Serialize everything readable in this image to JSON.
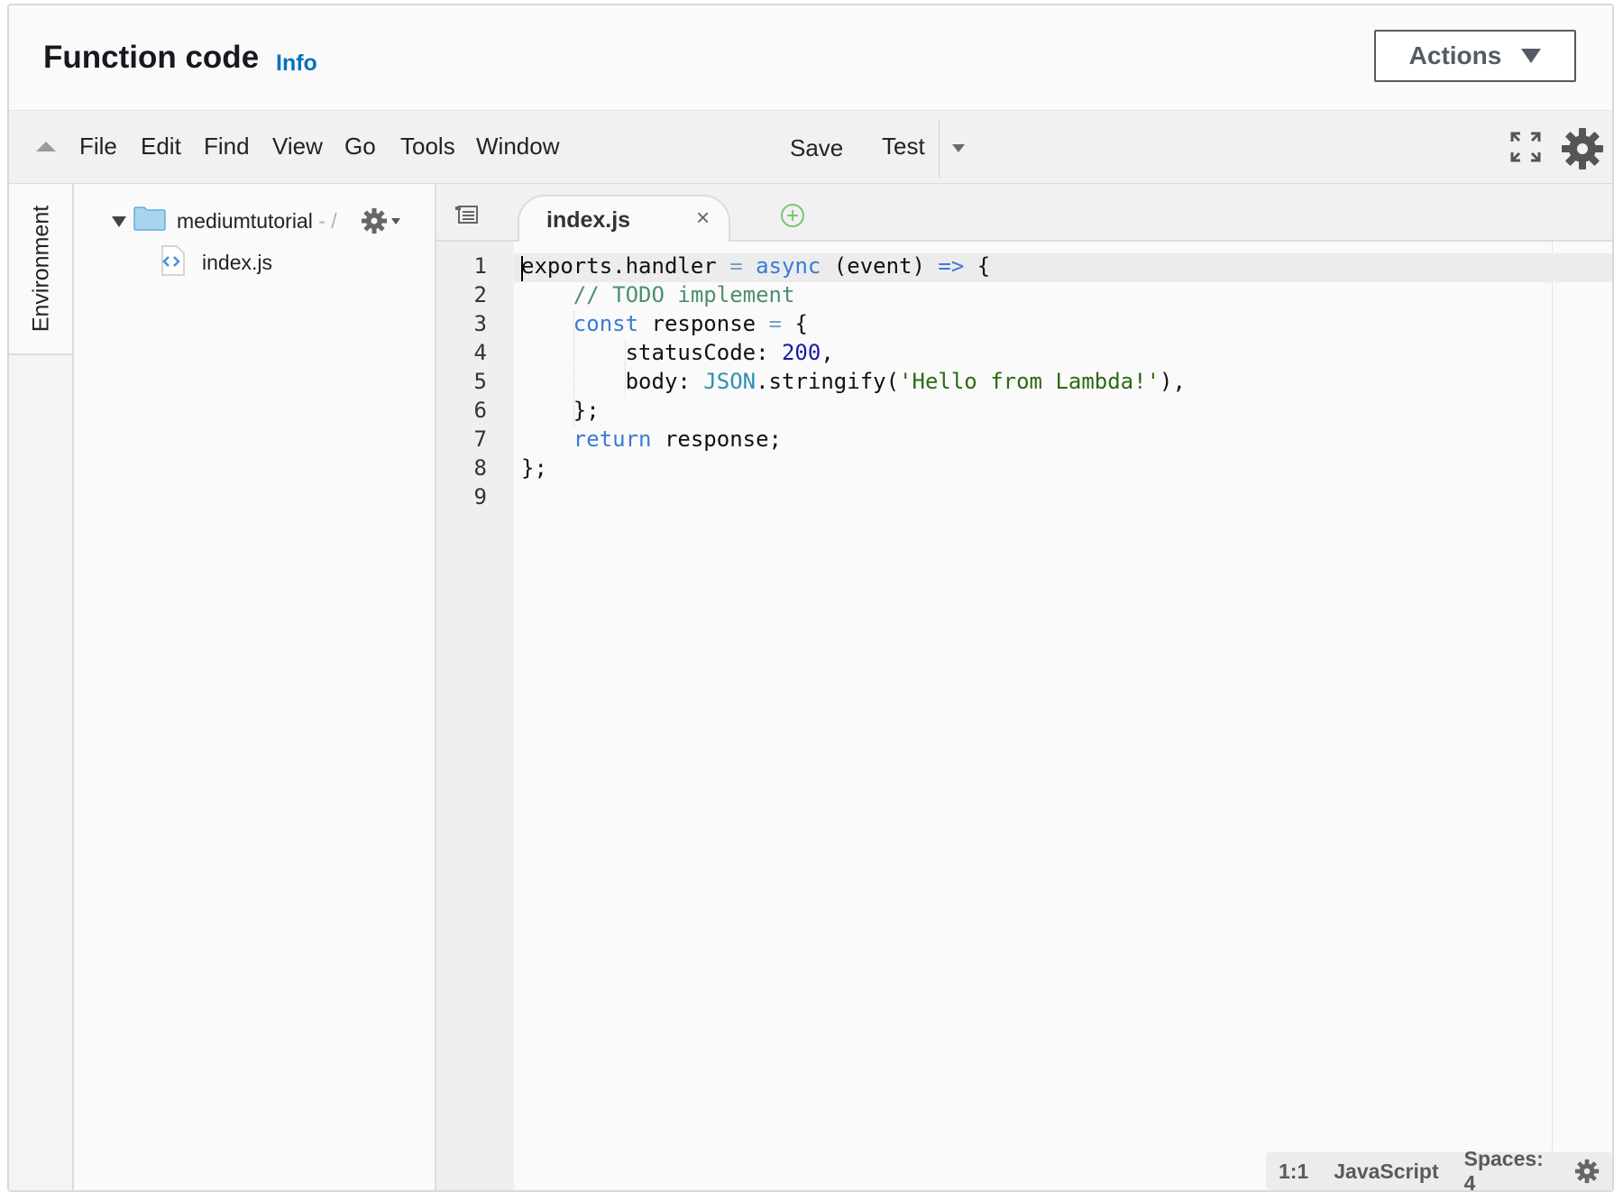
{
  "header": {
    "title": "Function code",
    "info_link": "Info",
    "actions_label": "Actions"
  },
  "menubar": {
    "items": [
      "File",
      "Edit",
      "Find",
      "View",
      "Go",
      "Tools",
      "Window"
    ],
    "save_label": "Save",
    "test_label": "Test"
  },
  "sidebar": {
    "environment_label": "Environment"
  },
  "tree": {
    "folder_name": "mediumtutorial",
    "folder_suffix": " - /",
    "file_name": "index.js"
  },
  "editor": {
    "tab_label": "index.js",
    "line_numbers": [
      "1",
      "2",
      "3",
      "4",
      "5",
      "6",
      "7",
      "8",
      "9"
    ],
    "code": {
      "l1": {
        "a": "xports.handler ",
        "b": "=",
        "c": " ",
        "d": "async",
        "e": " (event) ",
        "f": "=>",
        "g": " {",
        "first": "e"
      },
      "l2": {
        "indent": "    ",
        "comment": "// TODO implement"
      },
      "l3": {
        "indent": "    ",
        "kw": "const",
        "a": " response ",
        "op": "=",
        "b": " {"
      },
      "l4": {
        "indent": "        ",
        "a": "statusCode: ",
        "num": "200",
        "b": ","
      },
      "l5": {
        "indent": "        ",
        "a": "body: ",
        "obj": "JSON",
        "b": ".stringify(",
        "str": "'Hello from Lambda!'",
        "c": "),"
      },
      "l6": {
        "indent": "    ",
        "a": "};"
      },
      "l7": {
        "indent": "    ",
        "kw": "return",
        "a": " response;"
      },
      "l8": {
        "a": "};"
      }
    }
  },
  "status": {
    "position": "1:1",
    "language": "JavaScript",
    "spaces": "Spaces: 4"
  },
  "colors": {
    "link": "#0073bb",
    "keyword": "#3a7ad9",
    "comment": "#4d8f6f",
    "number": "#1a1aa6",
    "string": "#2a6a14"
  }
}
